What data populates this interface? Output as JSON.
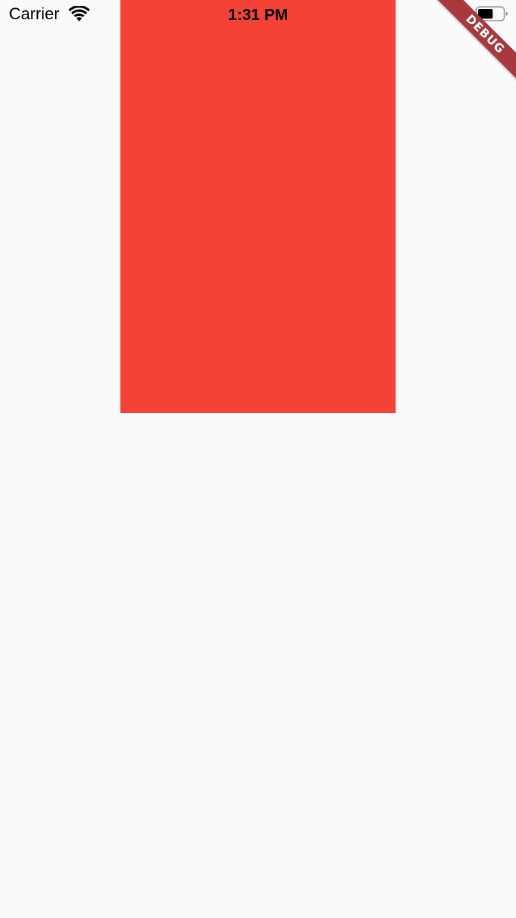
{
  "status_bar": {
    "carrier": "Carrier",
    "time": "1:31 PM",
    "wifi_icon": "wifi-icon",
    "battery_icon": "battery-icon"
  },
  "debug_banner": {
    "label": "DEBUG",
    "color": "#a8383c"
  },
  "content": {
    "box_color": "#f44336",
    "background_color": "#fafafa"
  }
}
